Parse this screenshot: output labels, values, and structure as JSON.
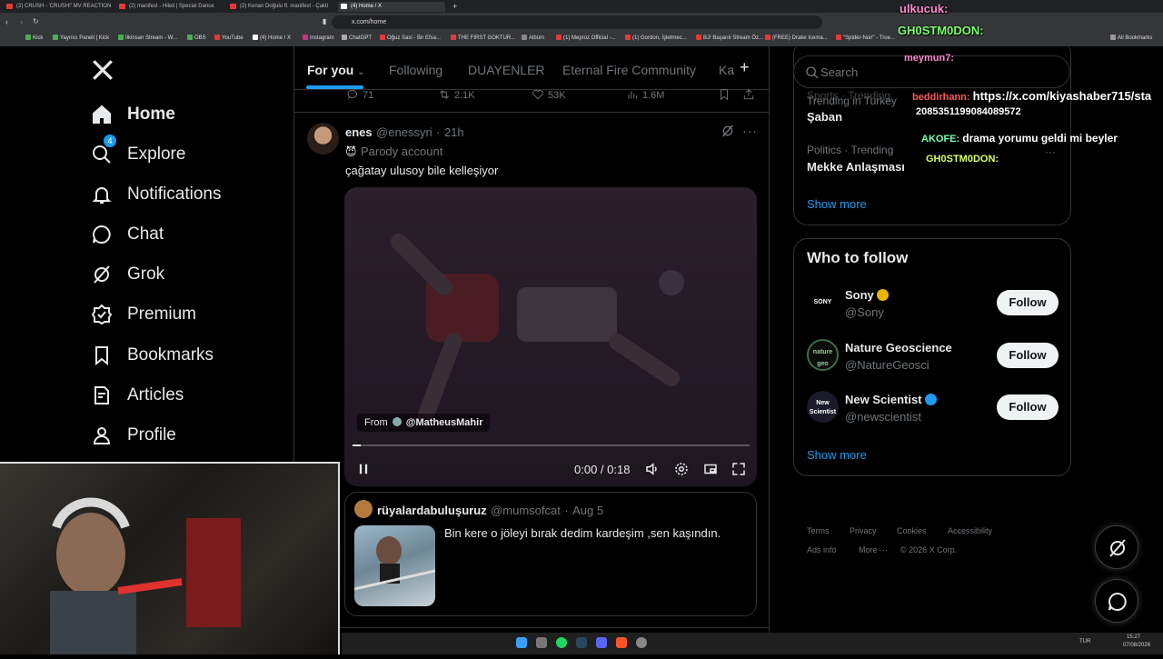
{
  "browser": {
    "tabs": [
      {
        "label": "(2) CRUSH - 'CRUSH!' MV REACTION",
        "active": false
      },
      {
        "label": "(2) manifest - Hileli | Special Dance",
        "active": false
      },
      {
        "label": "(2) Kenan Doğulu ft. manifest - Çakti",
        "active": false
      },
      {
        "label": "(4) Home / X",
        "active": true
      }
    ],
    "url": "x.com/home",
    "bookmarks": [
      "Kick",
      "Yayıncı Paneli | Kick",
      "İlkinsan Stream - W...",
      "OBS",
      "YouTube",
      "(4) Home / X",
      "Instagram",
      "ChatGPT",
      "Oğuz Sasi - Bir Efsa...",
      "THE FIRST GOKTUR...",
      "Albüm",
      "(1) Meproz Official -...",
      "(1) Gordon, İşletmec...",
      "BJ! Başarılı Stream Öz...",
      "(FREE) Drake Icema...",
      "\"Spider-Noir\" - True...",
      "All Bookmarks"
    ]
  },
  "nav": {
    "items": [
      {
        "label": "Home",
        "icon": "home-icon"
      },
      {
        "label": "Explore",
        "icon": "search-icon"
      },
      {
        "label": "Notifications",
        "icon": "bell-icon",
        "badge": "4"
      },
      {
        "label": "Chat",
        "icon": "chat-icon"
      },
      {
        "label": "Grok",
        "icon": "grok-icon"
      },
      {
        "label": "Premium",
        "icon": "premium-icon"
      },
      {
        "label": "Bookmarks",
        "icon": "bookmark-icon"
      },
      {
        "label": "Articles",
        "icon": "articles-icon"
      },
      {
        "label": "Profile",
        "icon": "profile-icon"
      }
    ]
  },
  "feed": {
    "tabs": [
      "For you",
      "Following",
      "DUAYENLER",
      "Eternal Fire Community",
      "Ka"
    ],
    "prev_post_stats": {
      "replies": "71",
      "reposts": "2.1K",
      "likes": "53K",
      "views": "1.6M"
    },
    "post": {
      "name": "enes",
      "handle": "@enessyri",
      "time": "21h",
      "label": "Parody account",
      "text": "çağatay ulusoy bile kelleşiyor",
      "video": {
        "from_label": "From",
        "from_handle": "@MatheusMahir",
        "time": "0:00 / 0:18",
        "progress": 0.02
      }
    },
    "quote": {
      "name": "rüyalardabuluşuruz",
      "handle": "@mumsofcat",
      "date": "Aug 5",
      "text": "Bin kere o jöleyi bırak dedim kardeşim ,sen kaşındın."
    }
  },
  "sidebar": {
    "search_placeholder": "Search",
    "trends_partial": "Sports · Trending",
    "trends": [
      {
        "category": "Trending in Turkey",
        "name": "Şaban"
      },
      {
        "category": "Politics · Trending",
        "name": "Mekke Anlaşması"
      }
    ],
    "show_more": "Show more",
    "who_to_follow_title": "Who to follow",
    "follow_label": "Follow",
    "suggestions": [
      {
        "name": "Sony",
        "handle": "@Sony",
        "avatar_text": "SONY",
        "verified": "gold"
      },
      {
        "name": "Nature Geoscience",
        "handle": "@NatureGeosci",
        "avatar_text": "nature geo",
        "verified": "none"
      },
      {
        "name": "New Scientist",
        "handle": "@newscientist",
        "avatar_text": "New Scientist",
        "verified": "blue"
      }
    ],
    "footer": [
      "Terms",
      "Privacy",
      "Cookies",
      "Accessibility",
      "Ads info",
      "More ···",
      "© 2026 X Corp."
    ]
  },
  "chat_overlay": [
    {
      "user": "ulkucuk:",
      "message": "",
      "color": "#ff8bd1"
    },
    {
      "user": "GH0STM0DON:",
      "message": "",
      "color": "#7dff6b"
    },
    {
      "user": "meymun7:",
      "message": "",
      "color": "#ff8bd1"
    },
    {
      "user": "beddirhann:",
      "message": "https://x.com/kiyashaber715/sta",
      "message2": "2085351199084089572",
      "color": "#ff5a5a"
    },
    {
      "user": "AKOFE:",
      "message": "drama yorumu geldi mi beyler",
      "color": "#7dffb0"
    },
    {
      "user": "GH0STM0DON:",
      "message": "",
      "color": "#d6ff6b"
    }
  ],
  "system": {
    "lang": "TUR",
    "time": "15:27",
    "date": "07/08/2026"
  },
  "colors": {
    "accent": "#1d9bf0",
    "background": "#000000",
    "text": "#e7e9ea",
    "muted": "#71767b",
    "border": "#2f3336"
  }
}
